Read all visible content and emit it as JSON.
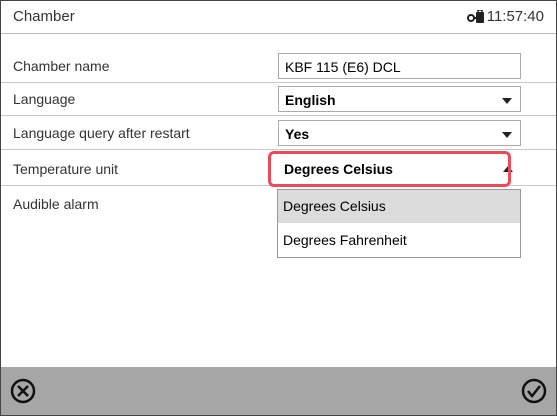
{
  "header": {
    "title": "Chamber",
    "time": "11:57:40"
  },
  "rows": [
    {
      "label": "Chamber name",
      "value": "KBF 115 (E6) DCL",
      "type": "text"
    },
    {
      "label": "Language",
      "value": "English",
      "type": "select"
    },
    {
      "label": "Language query after restart",
      "value": "Yes",
      "type": "select"
    },
    {
      "label": "Temperature unit",
      "value": "Degrees Celsius",
      "type": "select-open"
    },
    {
      "label": "Audible alarm",
      "value": "",
      "type": "select"
    }
  ],
  "dropdown": {
    "options": [
      "Degrees Celsius",
      "Degrees Fahrenheit"
    ],
    "selected_index": 0
  },
  "footer": {
    "cancel_icon": "cancel-icon",
    "confirm_icon": "checkmark-icon"
  },
  "colors": {
    "highlight": "#e94c58",
    "footer_bg": "#a6a6a6",
    "selected_option_bg": "#dcdcdc"
  }
}
